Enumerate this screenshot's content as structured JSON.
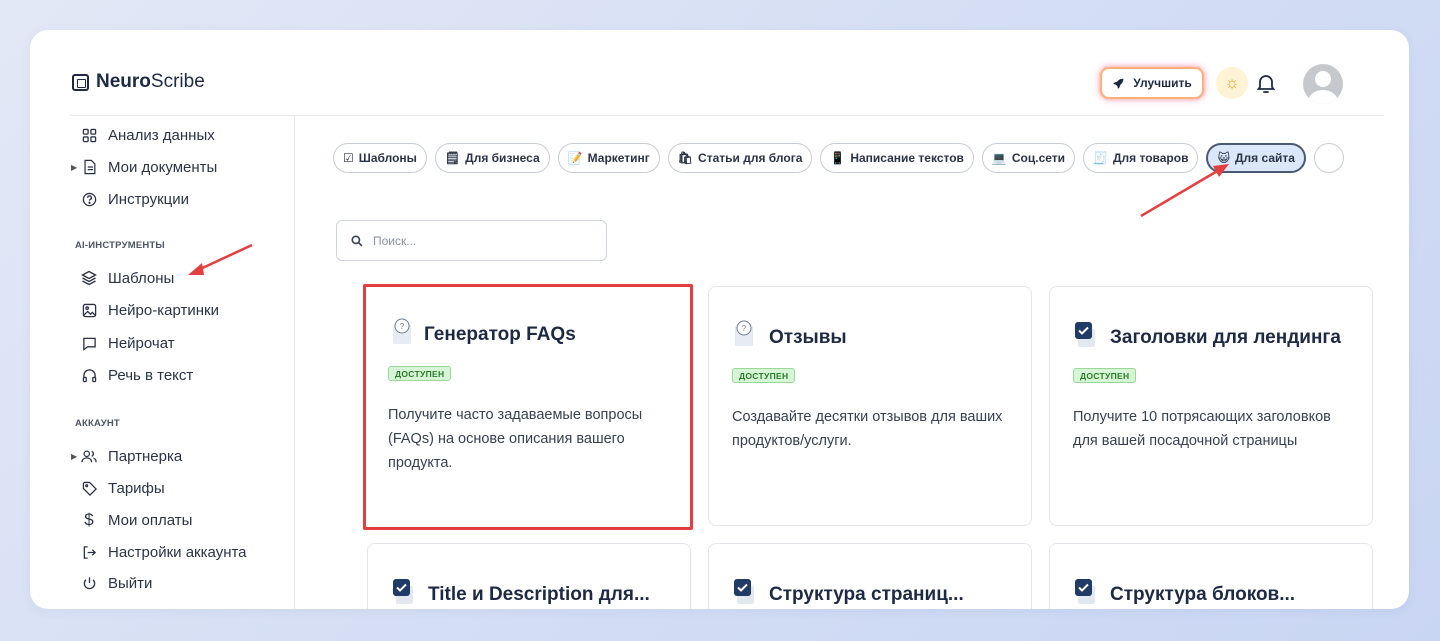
{
  "app": {
    "logo_bold": "Neuro",
    "logo_rest": "Scribe"
  },
  "header": {
    "upgrade_label": "Улучшить"
  },
  "sidebar": {
    "items_top": [
      {
        "label": "Анализ данных",
        "icon": "grid-icon"
      },
      {
        "label": "Мои документы",
        "icon": "document-icon",
        "expandable": true
      },
      {
        "label": "Инструкции",
        "icon": "help-circle-icon"
      }
    ],
    "section_ai": "AI-ИНСТРУМЕНТЫ",
    "items_ai": [
      {
        "label": "Шаблоны",
        "icon": "layers-icon",
        "active": true
      },
      {
        "label": "Нейро-картинки",
        "icon": "image-icon"
      },
      {
        "label": "Нейрочат",
        "icon": "chat-icon"
      },
      {
        "label": "Речь в текст",
        "icon": "headphones-icon"
      }
    ],
    "section_account": "АККАУНТ",
    "items_account": [
      {
        "label": "Партнерка",
        "icon": "users-icon",
        "expandable": true
      },
      {
        "label": "Тарифы",
        "icon": "tag-icon"
      },
      {
        "label": "Мои оплаты",
        "icon": "dollar-icon"
      },
      {
        "label": "Настройки аккаунта",
        "icon": "login-icon"
      },
      {
        "label": "Выйти",
        "icon": "power-icon"
      }
    ]
  },
  "chips": [
    {
      "label": "Шаблоны",
      "emoji": "☑"
    },
    {
      "label": "Для бизнеса",
      "emoji": "🗒"
    },
    {
      "label": "Маркетинг",
      "emoji": "📝"
    },
    {
      "label": "Статьи для блога",
      "emoji": "🛍"
    },
    {
      "label": "Написание текстов",
      "emoji": "📱"
    },
    {
      "label": "Соц.сети",
      "emoji": "💻"
    },
    {
      "label": "Для товаров",
      "emoji": "🧾"
    },
    {
      "label": "Для сайта",
      "emoji": "😺",
      "active": true
    }
  ],
  "search": {
    "placeholder": "Поиск..."
  },
  "cards": [
    {
      "title": "Генератор FAQs",
      "badge": "ДОСТУПЕН",
      "description": "Получите часто задаваемые вопросы (FAQs) на основе описания вашего продукта.",
      "icon": "faq-icon"
    },
    {
      "title": "Отзывы",
      "badge": "ДОСТУПЕН",
      "description": "Создавайте десятки отзывов для ваших продуктов/услуги.",
      "icon": "faq-icon"
    },
    {
      "title": "Заголовки для лендинга",
      "badge": "ДОСТУПЕН",
      "description": "Получите 10 потрясающих заголовков для вашей посадочной страницы",
      "icon": "checkbox-icon"
    },
    {
      "title": "Title и Description для...",
      "icon": "checkbox-icon"
    },
    {
      "title": "Структура страниц...",
      "icon": "checkbox-icon"
    },
    {
      "title": "Структура блоков...",
      "icon": "checkbox-icon"
    }
  ],
  "colors": {
    "accent_arrow": "#e53e3e",
    "badge_bg": "#d6f6d6",
    "chip_active_bg": "#dbe7fb"
  }
}
